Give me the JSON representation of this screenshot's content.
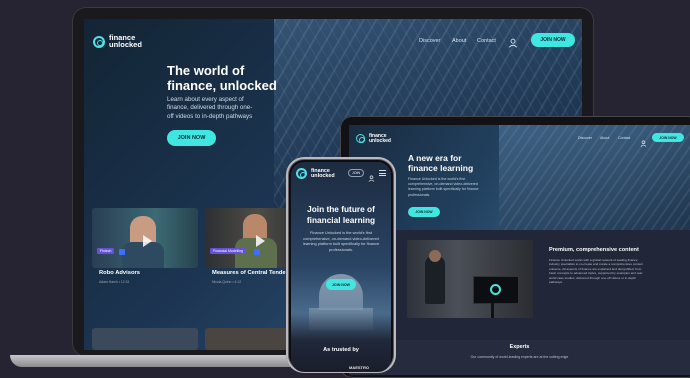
{
  "laptop": {
    "logo_line1": "finance",
    "logo_line2": "unlocked",
    "nav": [
      "Discover",
      "About",
      "Contact"
    ],
    "join_label": "JOIN NOW",
    "hero_title_1": "The world of",
    "hero_title_2": "finance, unlocked",
    "hero_sub_1": "Learn about every aspect of",
    "hero_sub_2": "finance, delivered through one-",
    "hero_sub_3": "off videos to in-depth pathways",
    "hero_button": "JOIN NOW",
    "cards": [
      {
        "tag": "Fintech",
        "title": "Robo Advisors",
        "meta": "Adam Harch • 12:31"
      },
      {
        "tag": "Financial Modelling",
        "title": "Measures of Central Tendencies",
        "meta": "Nicola Quinn • 4:12"
      }
    ]
  },
  "tablet": {
    "logo_line1": "finance",
    "logo_line2": "unlocked",
    "nav": [
      "Discover",
      "About",
      "Contact"
    ],
    "join_label": "JOIN NOW",
    "hero_title_1": "A new era for",
    "hero_title_2": "finance learning",
    "hero_body": "Finance Unlocked is the world's first comprehensive, on-demand video-delivered learning platform built specifically for finance professionals.",
    "hero_button": "JOIN NOW",
    "premium_title": "Premium, comprehensive content",
    "premium_body": "Finance Unlocked works with a global network of leading finance industry specialists to co-create and curate a comprehensive content universe. All aspects of finance are explained and demystified, from basic concepts to advanced topics, supported by examples and real-world case studies, delivered through one-off videos or in-depth pathways.",
    "experts_title": "Experts",
    "experts_body": "Our community of world-leading experts are at the cutting edge"
  },
  "phone": {
    "logo_line1": "finance",
    "logo_line2": "unlocked",
    "join_label": "JOIN",
    "hero_title_1": "Join the future of",
    "hero_title_2": "financial learning",
    "hero_body": "Finance Unlocked is the world's first comprehensive, on-demand video-delivered learning platform built specifically for finance professionals.",
    "hero_button": "JOIN NOW",
    "trusted_title": "As trusted by",
    "trusted_logo": "MAESTRO"
  },
  "colors": {
    "accent": "#40e7e0",
    "tag": "#6651d6",
    "background": "#262433"
  }
}
